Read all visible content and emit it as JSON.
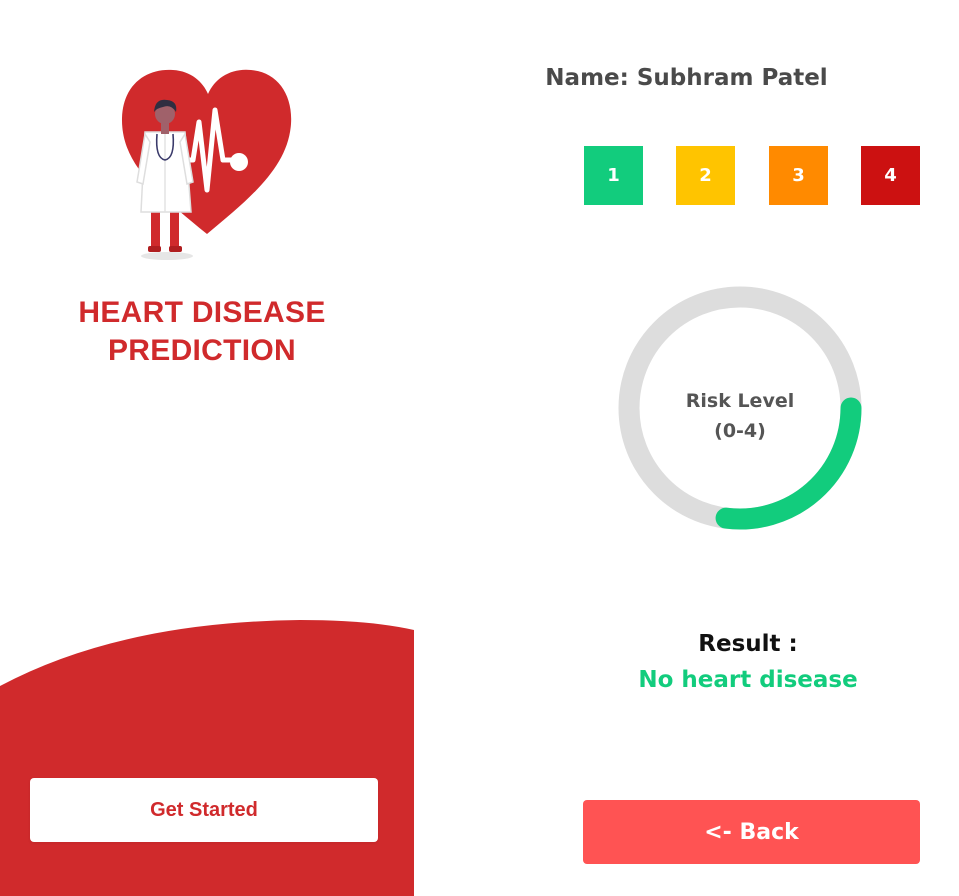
{
  "home": {
    "title_line1": "HEART DISEASE",
    "title_line2": "PREDICTION",
    "get_started_label": "Get Started",
    "brand_color": "#d02a2c",
    "hero_icon": "doctor-heart-illustration"
  },
  "result_screen": {
    "patient_name": "Name: Subhram Patel",
    "risk_levels": [
      {
        "label": "1",
        "color": "#12cc7d"
      },
      {
        "label": "2",
        "color": "#ffc400"
      },
      {
        "label": "3",
        "color": "#ff8a00"
      },
      {
        "label": "4",
        "color": "#cc1111"
      }
    ],
    "gauge": {
      "label_line1": "Risk Level",
      "label_line2": "(0-4)",
      "fill_fraction": 0.27,
      "fill_color": "#12cc7d",
      "track_color": "#dddddd"
    },
    "result_label": "Result :",
    "result_value": "No heart disease",
    "back_label": "<- Back",
    "back_color": "#ff5353"
  }
}
